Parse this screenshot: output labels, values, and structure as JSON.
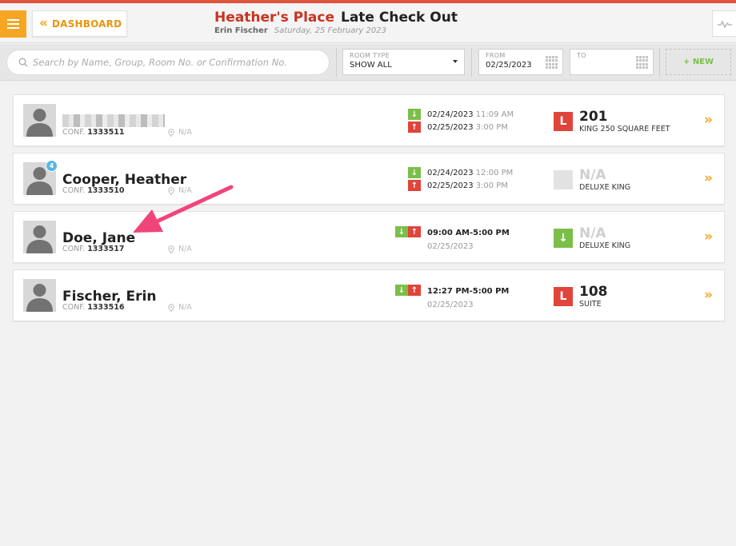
{
  "header": {
    "dashboard_label": "DASHBOARD",
    "hotel_name": "Heather's Place",
    "page_title": "Late Check Out",
    "user_name": "Erin Fischer",
    "date": "Saturday, 25 February 2023"
  },
  "toolbar": {
    "search_placeholder": "Search by Name, Group, Room No. or Confirmation No.",
    "room_type_label": "ROOM TYPE",
    "room_type_value": "SHOW ALL",
    "from_label": "FROM",
    "from_value": "02/25/2023",
    "to_label": "TO",
    "to_value": "",
    "new_label": "+ NEW"
  },
  "reservations": [
    {
      "name": "",
      "conf_label": "CONF.",
      "conf_no": "1333511",
      "location": "N/A",
      "arrival_date": "02/24/2023",
      "arrival_time": "11:09 AM",
      "departure_date": "02/25/2023",
      "departure_time": "3:00 PM",
      "room_icon": "L",
      "room_no": "201",
      "room_type": "KING 250 SQUARE FEET"
    },
    {
      "name": "Cooper, Heather",
      "badge": "4",
      "conf_label": "CONF.",
      "conf_no": "1333510",
      "location": "N/A",
      "arrival_date": "02/24/2023",
      "arrival_time": "12:00 PM",
      "departure_date": "02/25/2023",
      "departure_time": "3:00 PM",
      "room_no": "N/A",
      "room_type": "DELUXE KING"
    },
    {
      "name": "Doe, Jane",
      "conf_label": "CONF.",
      "conf_no": "1333517",
      "location": "N/A",
      "time_range": "09:00 AM-5:00 PM",
      "range_date": "02/25/2023",
      "room_no": "N/A",
      "room_type": "DELUXE KING"
    },
    {
      "name": "Fischer, Erin",
      "conf_label": "CONF.",
      "conf_no": "1333516",
      "location": "N/A",
      "time_range": "12:27 PM-5:00 PM",
      "range_date": "02/25/2023",
      "room_icon": "L",
      "room_no": "108",
      "room_type": "SUITE"
    }
  ],
  "colors": {
    "accent_orange": "#f6a623",
    "hotel_red": "#c8331e",
    "arrival_green": "#7bbf4a",
    "departure_red": "#e0443a",
    "badge_blue": "#59b7e0",
    "annotation_pink": "#f0457a"
  }
}
